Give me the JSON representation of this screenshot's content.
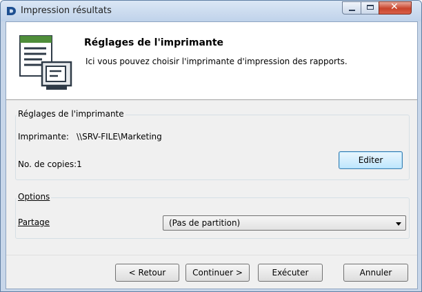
{
  "window": {
    "title": "Impression résultats"
  },
  "header": {
    "title": "Réglages de l'imprimante",
    "description": "Ici vous pouvez choisir l'imprimante d'impression des rapports."
  },
  "printer_group": {
    "legend": "Réglages de l'imprimante",
    "printer_label": "Imprimante:",
    "printer_value": "\\\\SRV-FILE\\Marketing",
    "copies_label": "No. de copies:1",
    "edit_button": "Editer"
  },
  "options_group": {
    "legend": "Options",
    "partage_label": "Partage",
    "partage_selected": "(Pas de partition)"
  },
  "footer": {
    "back_button": "< Retour",
    "continue_button": "Continuer >",
    "execute_button": "Exécuter",
    "cancel_button": "Annuler"
  },
  "icons": {
    "app": "d-logo-icon",
    "header": "document-print-icon",
    "minimize": "minimize-icon",
    "maximize": "maximize-icon",
    "close": "close-icon"
  },
  "colors": {
    "title_bar": "#c7d6e9",
    "logo": "#1d4f91",
    "close_button": "#c8442c",
    "default_button": "#bee6fd"
  }
}
